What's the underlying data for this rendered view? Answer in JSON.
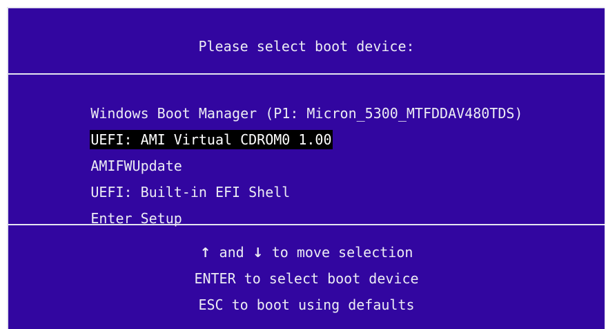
{
  "colors": {
    "background": "#3206a0",
    "text": "#ececf4",
    "highlight_bg": "#000000",
    "highlight_text": "#ffffff",
    "border": "#e6e6f0"
  },
  "title": "Please select boot device:",
  "boot_devices": [
    {
      "label": "Windows Boot Manager (P1: Micron_5300_MTFDDAV480TDS)",
      "selected": false
    },
    {
      "label": "UEFI: AMI Virtual CDROM0 1.00",
      "selected": true
    },
    {
      "label": "AMIFWUpdate",
      "selected": false
    },
    {
      "label": "UEFI: Built-in EFI Shell",
      "selected": false
    },
    {
      "label": "Enter Setup",
      "selected": false
    }
  ],
  "help": {
    "up_arrow": "↑",
    "and": " and ",
    "down_arrow": "↓",
    "move": " to move selection",
    "enter": "ENTER to select boot device",
    "esc": "ESC to boot using defaults"
  }
}
